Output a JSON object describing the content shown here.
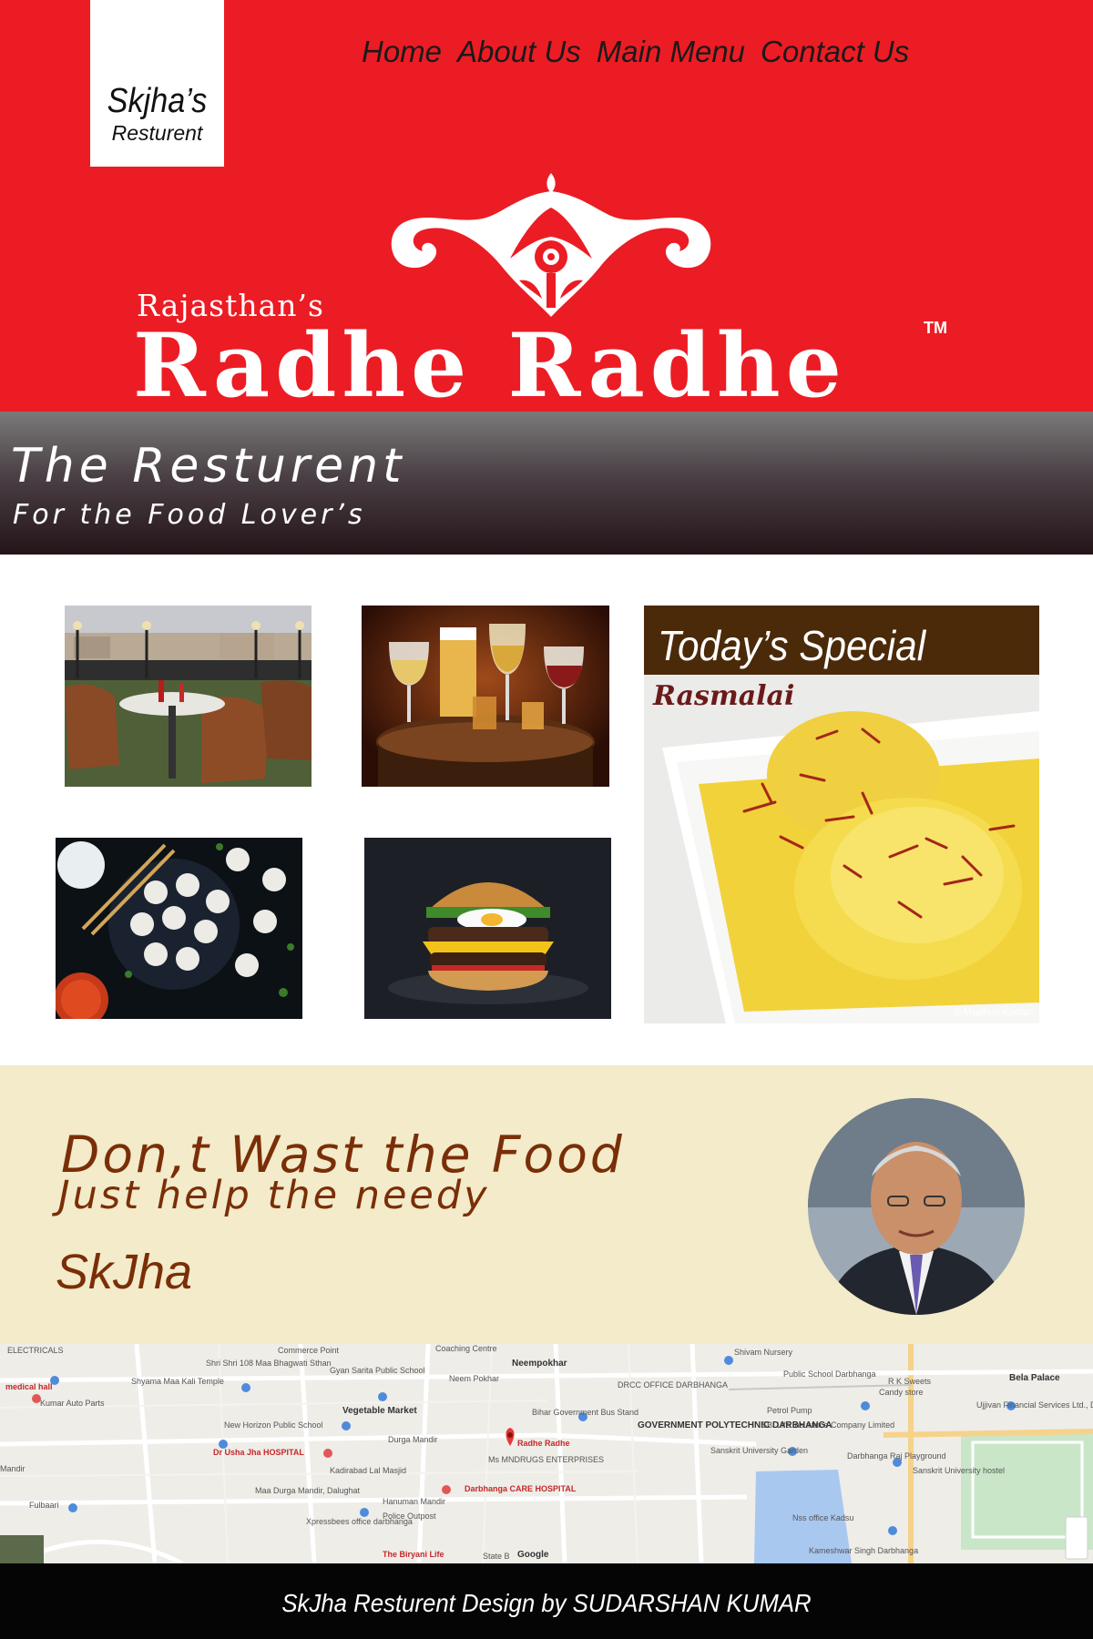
{
  "header": {
    "logo_name": "Skjha’s",
    "logo_sub": "Resturent",
    "nav": [
      "Home",
      "About Us",
      "Main Menu",
      "Contact Us"
    ],
    "brand_small": "Rajasthan’s",
    "brand_big": "Radhe Radhe",
    "brand_tm": "TM"
  },
  "tagline": {
    "title": "The Resturent",
    "subtitle": "For the Food Lover’s"
  },
  "special": {
    "title": "Today’s Special",
    "dish": "Rasmalai",
    "credit": "© Madhuri Kumar"
  },
  "quote": {
    "line1": "Don,t Wast the Food",
    "line2": "Just help the needy",
    "author": "SkJha"
  },
  "map": {
    "labels": [
      "Commerce Point",
      "Coaching Centre",
      "Shivam Nursery",
      "Shri Shri 108 Maa Bhagwati Sthan",
      "Gyan Sarita Public School",
      "Neempokhar",
      "Neem Pokhar",
      "DRCC OFFICE DARBHANGA",
      "Public School Darbhanga",
      "R K Sweets",
      "Candy store",
      "Bela Palace",
      "Ujjivan Financial Services Ltd., Darbhanga",
      "ELECTRICALS",
      "Shyama Maa Kali Temple",
      "medical hall",
      "Kumar Auto Parts",
      "Vegetable Market",
      "Bihar Government Bus Stand",
      "Petrol Pump",
      "SBI Life Insurance Company Limited",
      "GOVERNMENT POLYTECHNIC DARBHANGA",
      "New Horizon Public School",
      "Durga Mandir",
      "Radhe Radhe",
      "Sanskrit University Garden",
      "Darbhanga Raj Playground",
      "Dr Usha Jha HOSPITAL",
      "Kadirabad Lal Masjid",
      "Ms MNDRUGS ENTERPRISES",
      "Sanskrit University hostel",
      "Mandir",
      "Maa Durga Mandir, Dalughat",
      "Darbhanga CARE HOSPITAL",
      "Fulbaari",
      "Hanuman Mandir",
      "Police Outpost",
      "Xpressbees office darbhanga",
      "Nss office Kadsu",
      "Kameshwar Singh Darbhanga",
      "The Biryani Life",
      "State B",
      "Google"
    ]
  },
  "footer": {
    "credit": "SkJha Resturent Design by SUDARSHAN KUMAR"
  }
}
